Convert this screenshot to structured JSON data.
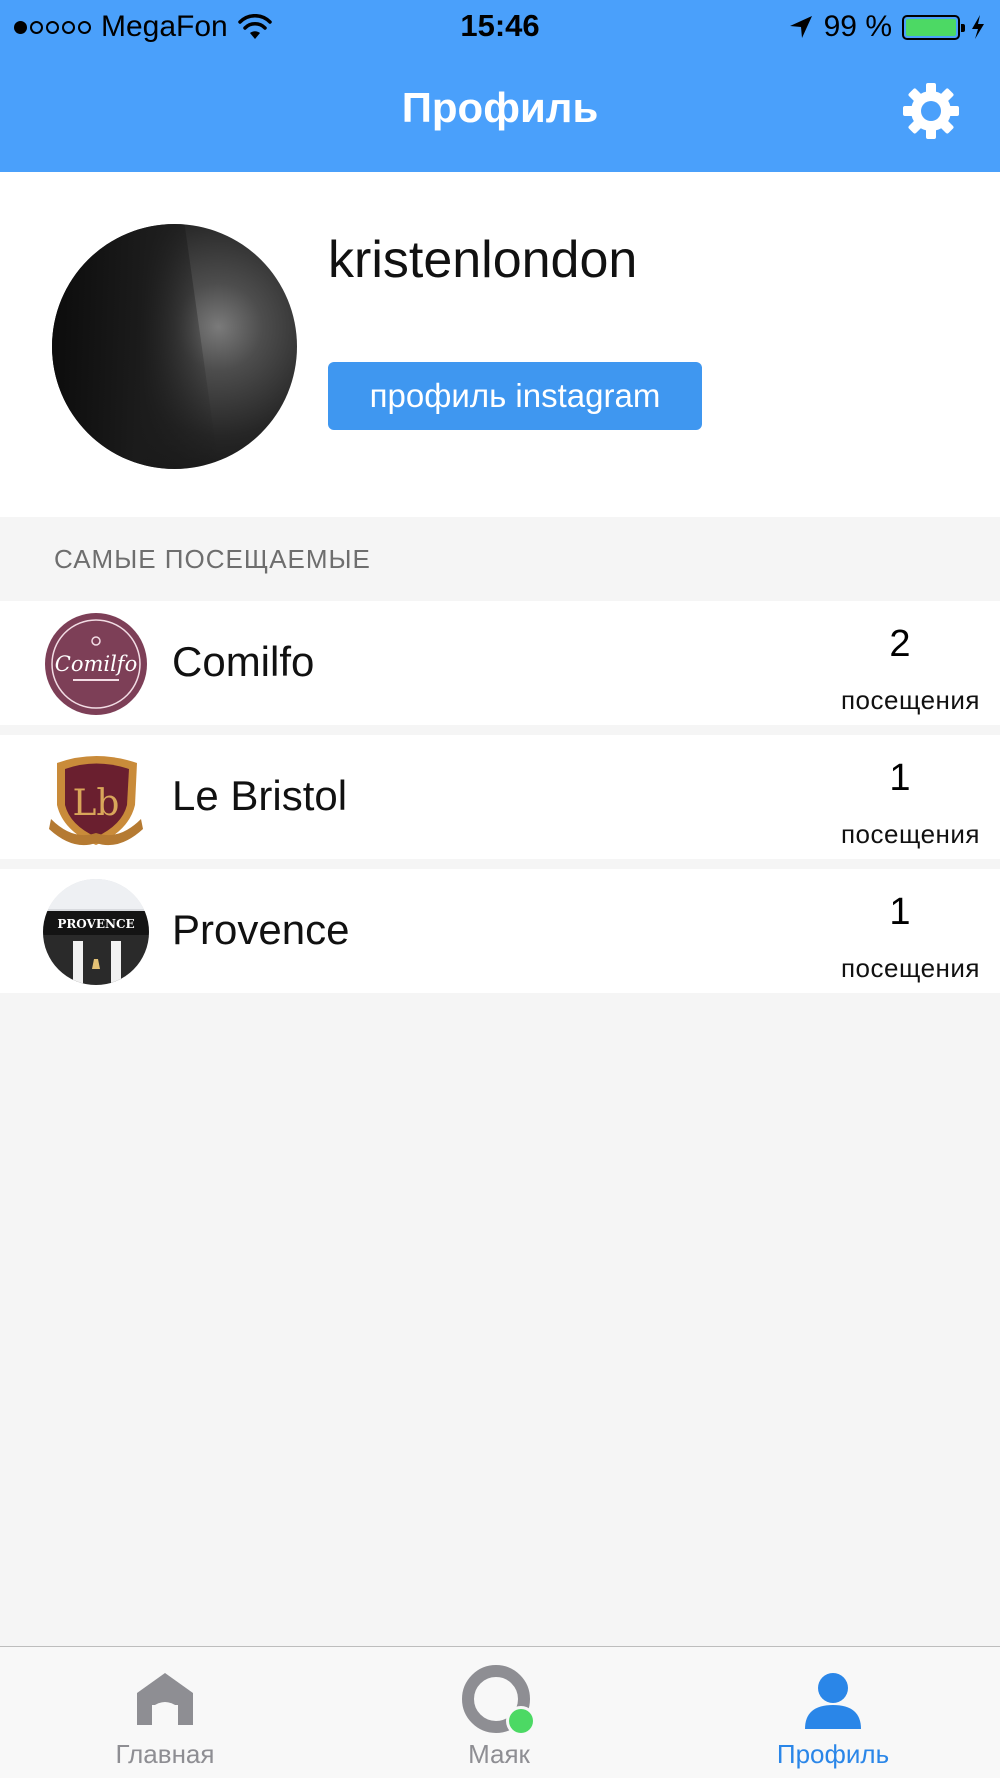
{
  "status_bar": {
    "carrier": "MegaFon",
    "time": "15:46",
    "battery": "99 %",
    "battery_level": 0.99
  },
  "header": {
    "title": "Профиль",
    "settings_icon": "gear-icon"
  },
  "profile": {
    "username": "kristenlondon",
    "instagram_button": "профиль instagram"
  },
  "section": {
    "title": "САМЫЕ ПОСЕЩАЕМЫЕ"
  },
  "places": [
    {
      "name": "Comilfo",
      "count": "2",
      "label": "посещения",
      "logo_text": "Comilfo"
    },
    {
      "name": "Le Bristol",
      "count": "1",
      "label": "посещения",
      "logo_text": "Lb"
    },
    {
      "name": "Provence",
      "count": "1",
      "label": "посещения",
      "logo_text": "PROVENCE"
    }
  ],
  "tabs": [
    {
      "label": "Главная",
      "icon": "home-icon",
      "active": false
    },
    {
      "label": "Маяк",
      "icon": "beacon-icon",
      "active": false
    },
    {
      "label": "Профиль",
      "icon": "person-icon",
      "active": true
    }
  ],
  "colors": {
    "header_bg": "#4aa0fb",
    "button_bg": "#3f97f0",
    "active_tab": "#2a86e8",
    "beacon_dot": "#4cd964"
  }
}
